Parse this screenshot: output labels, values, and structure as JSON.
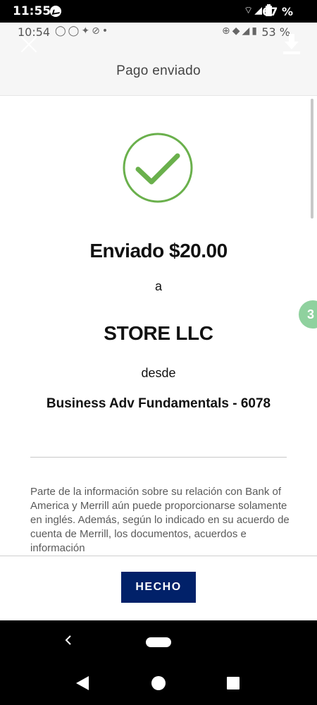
{
  "outer_status": {
    "time": "11:55",
    "battery": "67 %",
    "icons": [
      "messenger-icon",
      "wifi-icon",
      "signal-icon",
      "battery-icon"
    ]
  },
  "inner_status": {
    "time": "10:54",
    "battery": "53 %",
    "left_icons": [
      "whatsapp-icon",
      "messenger-icon",
      "notification-icon",
      "sync-icon"
    ],
    "right_icons": [
      "data-saver-icon",
      "wifi-icon",
      "signal-icon"
    ]
  },
  "header": {
    "title": "Pago enviado"
  },
  "confirmation": {
    "sent_amount": "Enviado $20.00",
    "to_label": "a",
    "recipient": "STORE LLC",
    "from_label": "desde",
    "account": "Business Adv Fundamentals - 6078"
  },
  "disclaimer": "Parte de la información sobre su relación con Bank of America y Merrill aún puede proporcionarse solamente en inglés. Además, según lo indicado en su acuerdo de cuenta de Merrill, los documentos, acuerdos e información",
  "chat_bubble": {
    "label": "3"
  },
  "footer": {
    "done_label": "HECHO"
  },
  "colors": {
    "check_green": "#6ab04c",
    "button_navy": "#012169"
  }
}
